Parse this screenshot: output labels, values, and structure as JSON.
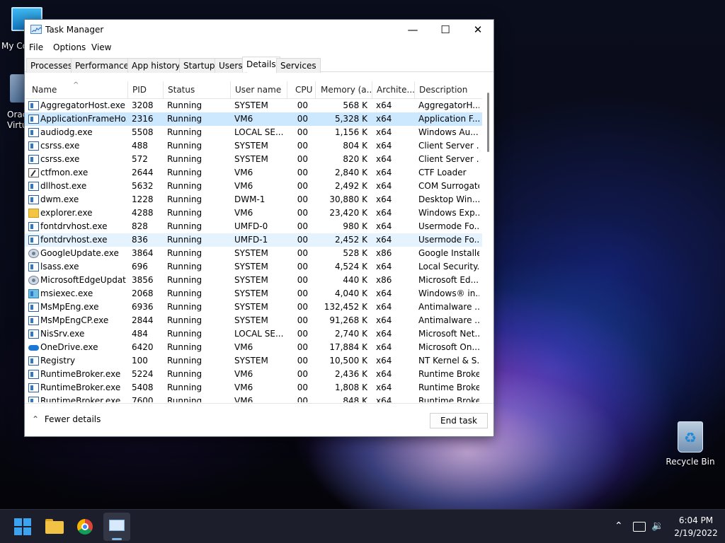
{
  "desktop": {
    "icons": {
      "my_computer": "My Co",
      "oracle_line1": "Orac",
      "oracle_line2": "Virtu",
      "recycle_bin": "Recycle Bin"
    }
  },
  "window": {
    "title": "Task Manager",
    "menu": [
      "File",
      "Options",
      "View"
    ],
    "tabs": [
      "Processes",
      "Performance",
      "App history",
      "Startup",
      "Users",
      "Details",
      "Services"
    ],
    "active_tab": "Details",
    "columns": [
      "Name",
      "PID",
      "Status",
      "User name",
      "CPU",
      "Memory (a...",
      "Archite...",
      "Description"
    ],
    "sort_indicator": "^",
    "rows": [
      {
        "icon": "app-icon",
        "name": "AggregatorHost.exe",
        "pid": "3208",
        "status": "Running",
        "user": "SYSTEM",
        "cpu": "00",
        "mem": "568 K",
        "arch": "x64",
        "desc": "AggregatorH..."
      },
      {
        "icon": "app-icon",
        "name": "ApplicationFrameHo...",
        "pid": "2316",
        "status": "Running",
        "user": "VM6",
        "cpu": "00",
        "mem": "5,328 K",
        "arch": "x64",
        "desc": "Application F..."
      },
      {
        "icon": "app-icon",
        "name": "audiodg.exe",
        "pid": "5508",
        "status": "Running",
        "user": "LOCAL SE...",
        "cpu": "00",
        "mem": "1,156 K",
        "arch": "x64",
        "desc": "Windows Au..."
      },
      {
        "icon": "app-icon",
        "name": "csrss.exe",
        "pid": "488",
        "status": "Running",
        "user": "SYSTEM",
        "cpu": "00",
        "mem": "804 K",
        "arch": "x64",
        "desc": "Client Server ..."
      },
      {
        "icon": "app-icon",
        "name": "csrss.exe",
        "pid": "572",
        "status": "Running",
        "user": "SYSTEM",
        "cpu": "00",
        "mem": "820 K",
        "arch": "x64",
        "desc": "Client Server ..."
      },
      {
        "icon": "pen-icon",
        "name": "ctfmon.exe",
        "pid": "2644",
        "status": "Running",
        "user": "VM6",
        "cpu": "00",
        "mem": "2,840 K",
        "arch": "x64",
        "desc": "CTF Loader"
      },
      {
        "icon": "app-icon",
        "name": "dllhost.exe",
        "pid": "5632",
        "status": "Running",
        "user": "VM6",
        "cpu": "00",
        "mem": "2,492 K",
        "arch": "x64",
        "desc": "COM Surrogate"
      },
      {
        "icon": "app-icon",
        "name": "dwm.exe",
        "pid": "1228",
        "status": "Running",
        "user": "DWM-1",
        "cpu": "00",
        "mem": "30,880 K",
        "arch": "x64",
        "desc": "Desktop Win..."
      },
      {
        "icon": "folder-icon",
        "name": "explorer.exe",
        "pid": "4288",
        "status": "Running",
        "user": "VM6",
        "cpu": "00",
        "mem": "23,420 K",
        "arch": "x64",
        "desc": "Windows Exp..."
      },
      {
        "icon": "app-icon",
        "name": "fontdrvhost.exe",
        "pid": "828",
        "status": "Running",
        "user": "UMFD-0",
        "cpu": "00",
        "mem": "980 K",
        "arch": "x64",
        "desc": "Usermode Fo..."
      },
      {
        "icon": "app-icon",
        "name": "fontdrvhost.exe",
        "pid": "836",
        "status": "Running",
        "user": "UMFD-1",
        "cpu": "00",
        "mem": "2,452 K",
        "arch": "x64",
        "desc": "Usermode Fo..."
      },
      {
        "icon": "gear-icon",
        "name": "GoogleUpdate.exe",
        "pid": "3864",
        "status": "Running",
        "user": "SYSTEM",
        "cpu": "00",
        "mem": "528 K",
        "arch": "x86",
        "desc": "Google Installer"
      },
      {
        "icon": "app-icon",
        "name": "lsass.exe",
        "pid": "696",
        "status": "Running",
        "user": "SYSTEM",
        "cpu": "00",
        "mem": "4,524 K",
        "arch": "x64",
        "desc": "Local Security..."
      },
      {
        "icon": "gear-icon",
        "name": "MicrosoftEdgeUpdat...",
        "pid": "3856",
        "status": "Running",
        "user": "SYSTEM",
        "cpu": "00",
        "mem": "440 K",
        "arch": "x86",
        "desc": "Microsoft Ed..."
      },
      {
        "icon": "installer-icon",
        "name": "msiexec.exe",
        "pid": "2068",
        "status": "Running",
        "user": "SYSTEM",
        "cpu": "00",
        "mem": "4,040 K",
        "arch": "x64",
        "desc": "Windows® in..."
      },
      {
        "icon": "app-icon",
        "name": "MsMpEng.exe",
        "pid": "6936",
        "status": "Running",
        "user": "SYSTEM",
        "cpu": "00",
        "mem": "132,452 K",
        "arch": "x64",
        "desc": "Antimalware ..."
      },
      {
        "icon": "app-icon",
        "name": "MsMpEngCP.exe",
        "pid": "2844",
        "status": "Running",
        "user": "SYSTEM",
        "cpu": "00",
        "mem": "91,268 K",
        "arch": "x64",
        "desc": "Antimalware ..."
      },
      {
        "icon": "app-icon",
        "name": "NisSrv.exe",
        "pid": "484",
        "status": "Running",
        "user": "LOCAL SE...",
        "cpu": "00",
        "mem": "2,740 K",
        "arch": "x64",
        "desc": "Microsoft Net..."
      },
      {
        "icon": "cloud-icon",
        "name": "OneDrive.exe",
        "pid": "6420",
        "status": "Running",
        "user": "VM6",
        "cpu": "00",
        "mem": "17,884 K",
        "arch": "x64",
        "desc": "Microsoft On..."
      },
      {
        "icon": "app-icon",
        "name": "Registry",
        "pid": "100",
        "status": "Running",
        "user": "SYSTEM",
        "cpu": "00",
        "mem": "10,500 K",
        "arch": "x64",
        "desc": "NT Kernel & S..."
      },
      {
        "icon": "app-icon",
        "name": "RuntimeBroker.exe",
        "pid": "5224",
        "status": "Running",
        "user": "VM6",
        "cpu": "00",
        "mem": "2,436 K",
        "arch": "x64",
        "desc": "Runtime Broker"
      },
      {
        "icon": "app-icon",
        "name": "RuntimeBroker.exe",
        "pid": "5408",
        "status": "Running",
        "user": "VM6",
        "cpu": "00",
        "mem": "1,808 K",
        "arch": "x64",
        "desc": "Runtime Broker"
      },
      {
        "icon": "app-icon",
        "name": "RuntimeBroker.exe",
        "pid": "7600",
        "status": "Running",
        "user": "VM6",
        "cpu": "00",
        "mem": "848 K",
        "arch": "x64",
        "desc": "Runtime Broker"
      }
    ],
    "selected_row": 1,
    "hover_row": 10,
    "footer": {
      "fewer_details": "Fewer details",
      "end_task": "End task"
    }
  },
  "taskbar": {
    "clock_time": "6:04 PM",
    "clock_date": "2/19/2022",
    "accent": "#3ba3f0"
  }
}
